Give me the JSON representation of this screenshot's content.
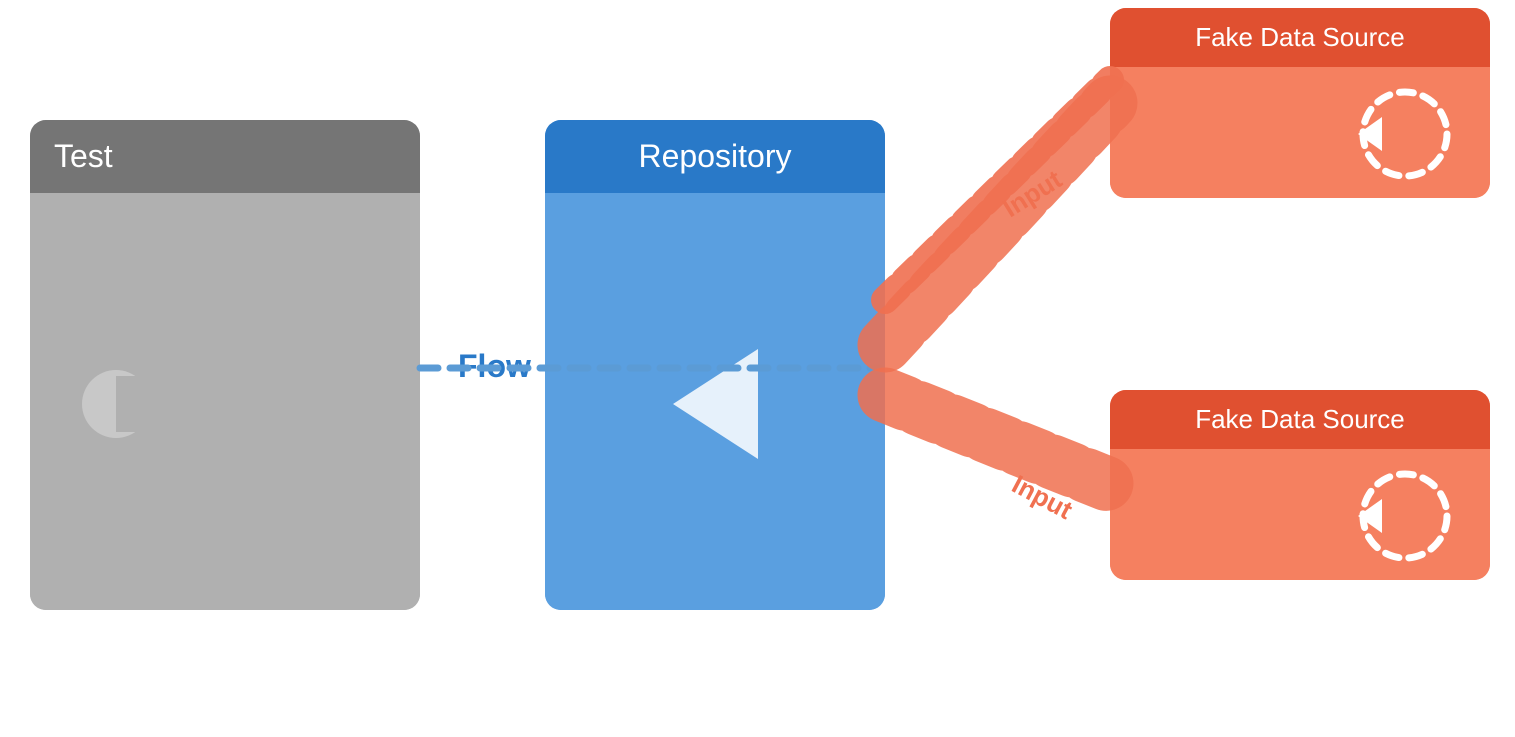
{
  "test_block": {
    "header": "Test"
  },
  "repo_block": {
    "header": "Repository"
  },
  "fake_source_top": {
    "header": "Fake Data Source",
    "input_label": "Input"
  },
  "fake_source_bottom": {
    "header": "Fake Data Source",
    "input_label": "Input"
  },
  "flow_label": "Flow",
  "colors": {
    "test_header": "#757575",
    "test_body": "#b0b0b0",
    "repo_blue": "#4a90d9",
    "repo_dark_blue": "#2979c8",
    "fake_orange": "#f07050",
    "fake_dark_orange": "#e05030",
    "flow_blue": "#2979c8",
    "connection_blue": "#5b9bd5",
    "connection_orange": "#f07050"
  }
}
